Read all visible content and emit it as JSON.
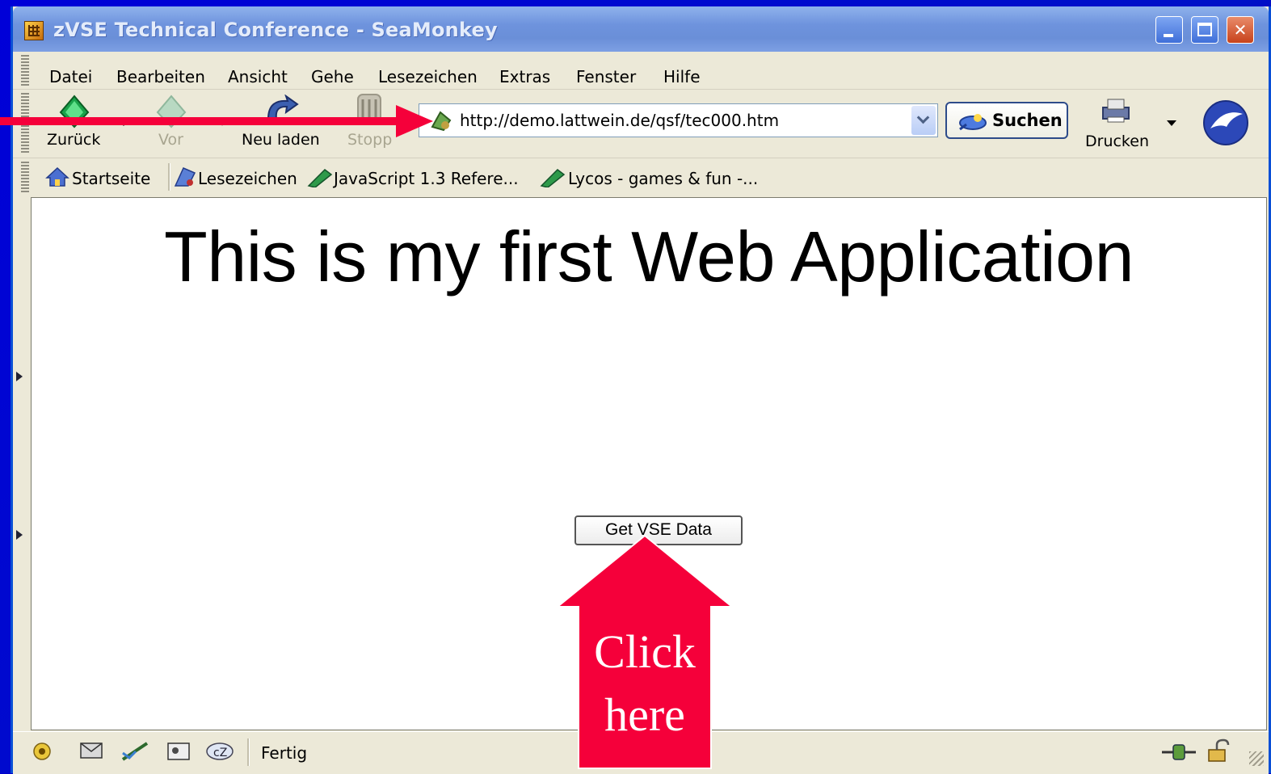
{
  "window": {
    "title": "zVSE Technical Conference - SeaMonkey",
    "controls": {
      "minimize": "minimize-icon",
      "maximize": "maximize-icon",
      "close": "close-icon"
    }
  },
  "menu": {
    "items": [
      "Datei",
      "Bearbeiten",
      "Ansicht",
      "Gehe",
      "Lesezeichen",
      "Extras",
      "Fenster",
      "Hilfe"
    ]
  },
  "toolbar": {
    "back_label": "Zurück",
    "forward_label": "Vor",
    "reload_label": "Neu laden",
    "stop_label": "Stopp",
    "url": "http://demo.lattwein.de/qsf/tec000.htm",
    "search_label": "Suchen",
    "print_label": "Drucken"
  },
  "bookmarks": {
    "items": [
      "Startseite",
      "Lesezeichen",
      "JavaScript 1.3 Refere...",
      "Lycos - games & fun -..."
    ]
  },
  "page": {
    "heading": "This is my first Web Application",
    "button_label": "Get VSE Data"
  },
  "status": {
    "text": "Fertig"
  },
  "annotation": {
    "callout_line1": "Click",
    "callout_line2": "here",
    "color": "#f5003a"
  },
  "colors": {
    "slide_background": "#0000cc",
    "title_bar": "#6e93dd",
    "chrome": "#ece9d8"
  }
}
